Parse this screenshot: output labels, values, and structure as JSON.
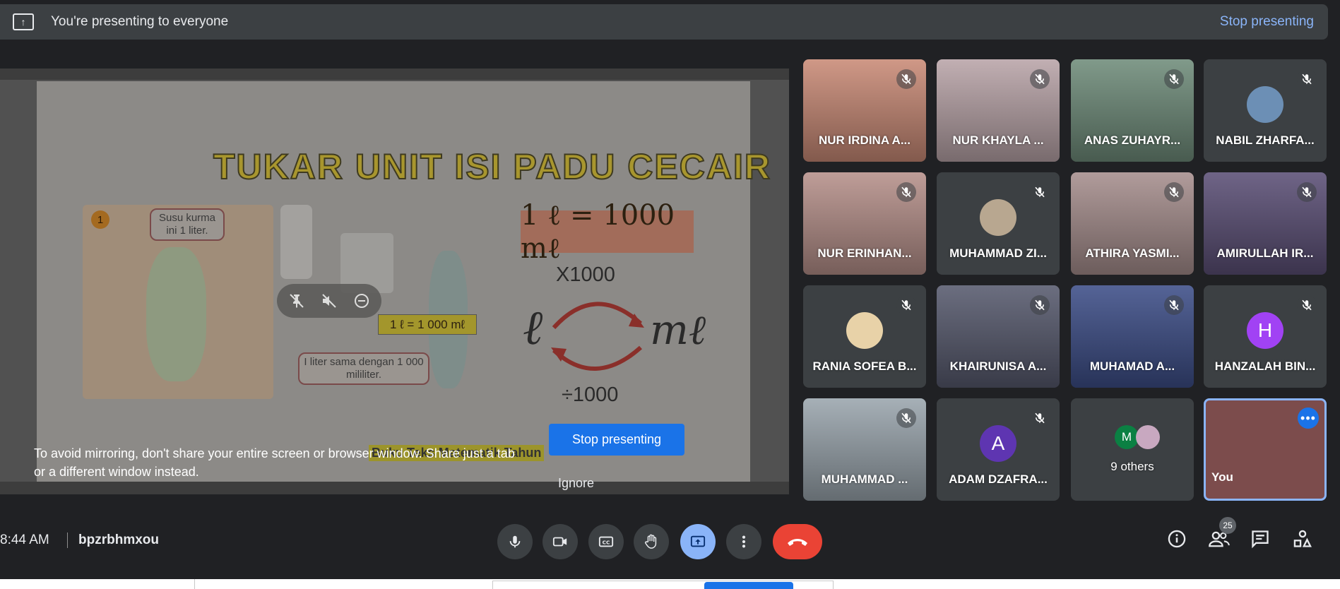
{
  "banner": {
    "message": "You're presenting to everyone",
    "stop_link": "Stop presenting"
  },
  "slide": {
    "title": "TUKAR UNIT ISI PADU CECAIR",
    "badge": "1",
    "bubble_top": "Susu kurma ini 1 liter.",
    "bubble_bottom": "I liter sama dengan 1 000 mililiter.",
    "equation_large": "1 ℓ = 1000 mℓ",
    "equation_small": "1 ℓ = 1 000 mℓ",
    "multiply": "X1000",
    "divide": "÷1000",
    "unit_left": "ℓ",
    "unit_right": "mℓ",
    "book_label": "Buku Teks Matematik Tahun"
  },
  "overlay": {
    "warning": "To avoid mirroring, don't share your entire screen or browser window. Share just a tab or a different window instead.",
    "stop_button": "Stop presenting",
    "ignore_button": "Ignore"
  },
  "participants": [
    {
      "name": "NUR IRDINA A...",
      "bg": "#c98a76",
      "type": "video"
    },
    {
      "name": "NUR KHAYLA ...",
      "bg": "#b9a4a8",
      "type": "video"
    },
    {
      "name": "ANAS ZUHAYR...",
      "bg": "#6f8c7a",
      "type": "video"
    },
    {
      "name": "NABIL ZHARFA...",
      "bg": "#3c4043",
      "type": "avatar",
      "avatar_color": "#6c8fb5",
      "initial": ""
    },
    {
      "name": "NUR ERINHAN...",
      "bg": "#b6908a",
      "type": "video"
    },
    {
      "name": "MUHAMMAD ZI...",
      "bg": "#3c4043",
      "type": "avatar",
      "avatar_color": "#b8a790",
      "initial": ""
    },
    {
      "name": "ATHIRA YASMI...",
      "bg": "#a68e8d",
      "type": "video"
    },
    {
      "name": "AMIRULLAH IR...",
      "bg": "#5b4f76",
      "type": "video"
    },
    {
      "name": "RANIA SOFEA B...",
      "bg": "#3c4043",
      "type": "avatar",
      "avatar_color": "#e8d2a8",
      "initial": ""
    },
    {
      "name": "KHAIRUNISA A...",
      "bg": "#575a6e",
      "type": "video"
    },
    {
      "name": "MUHAMAD A...",
      "bg": "#3d4e88",
      "type": "video"
    },
    {
      "name": "HANZALAH BIN...",
      "bg": "#3c4043",
      "type": "avatar",
      "avatar_color": "#a142f4",
      "initial": "H"
    },
    {
      "name": "MUHAMMAD ...",
      "bg": "#9aa5ad",
      "type": "video"
    },
    {
      "name": "ADAM DZAFRA...",
      "bg": "#3c4043",
      "type": "avatar",
      "avatar_color": "#5e35b1",
      "initial": "A"
    },
    {
      "name": "9 others",
      "bg": "#3c4043",
      "type": "others",
      "initial": "M"
    },
    {
      "name": "You",
      "bg": "#7c4c4c",
      "type": "you"
    }
  ],
  "bottom": {
    "time": "8:44 AM",
    "meeting_code": "bpzrbhmxou",
    "people_count": "25"
  },
  "colors": {
    "accent": "#1a73e8",
    "link": "#8ab4f8",
    "end_call": "#ea4335",
    "surface": "#3c4043",
    "background": "#202124"
  },
  "icons": {
    "banner": "present-to-all-icon",
    "mic": "mic-icon",
    "camera": "camera-icon",
    "captions": "closed-captions-icon",
    "hand": "raise-hand-icon",
    "present": "present-now-icon",
    "more": "more-vert-icon",
    "end": "end-call-icon",
    "info": "info-icon",
    "people": "people-icon",
    "chat": "chat-icon",
    "activities": "activities-icon"
  }
}
